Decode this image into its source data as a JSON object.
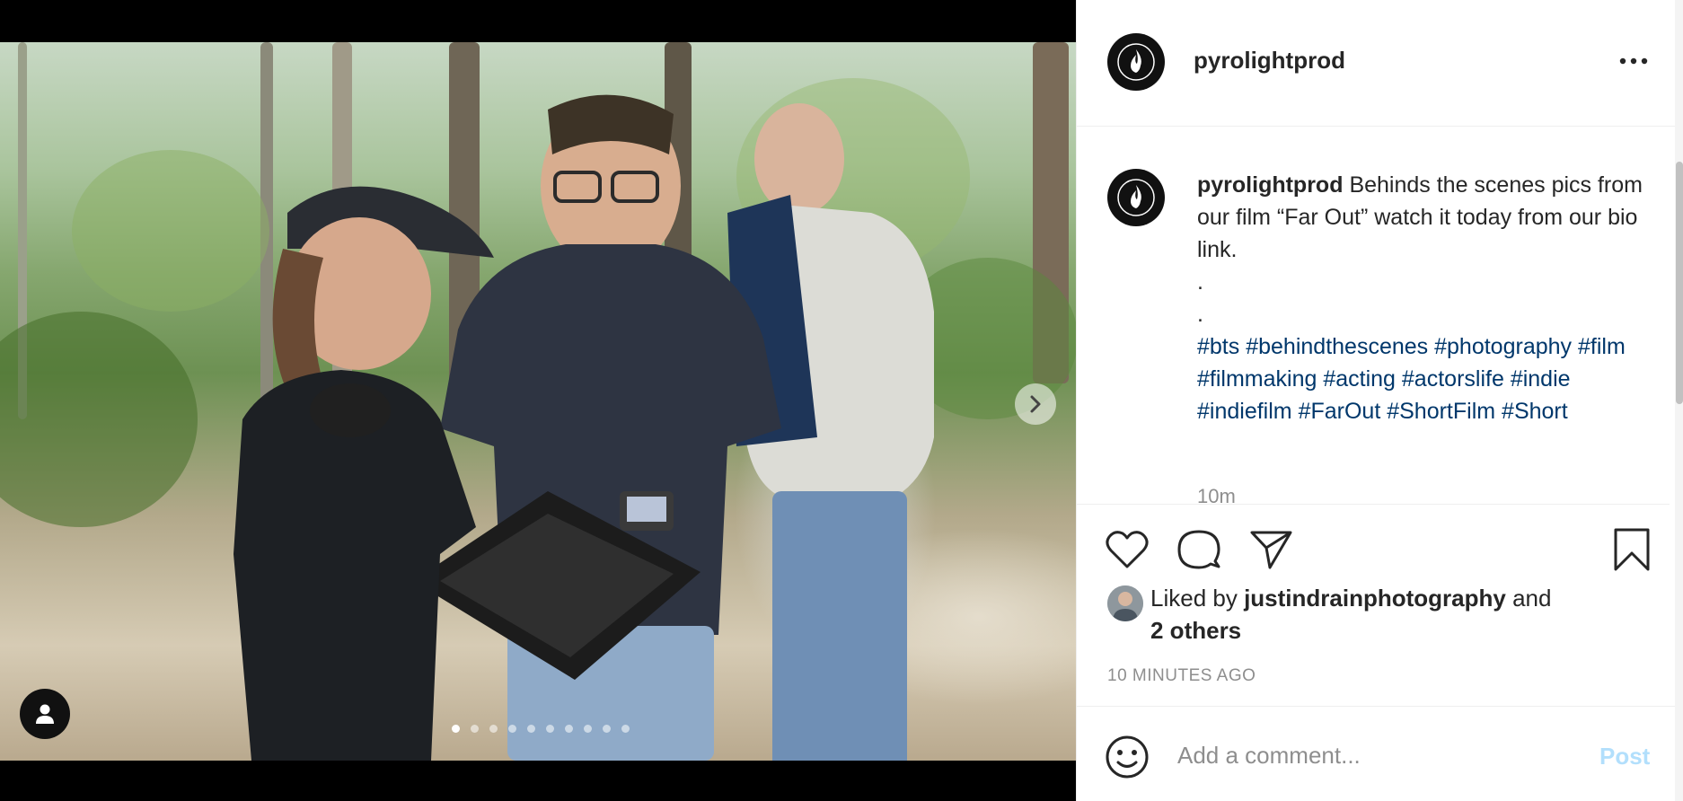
{
  "post": {
    "username": "pyrolightprod",
    "media": {
      "carousel_count": 10,
      "active_index": 0,
      "next_icon": "chevron-right-icon",
      "user_tag_icon": "person-icon"
    },
    "header": {
      "username": "pyrolightprod",
      "more_icon": "more-horizontal-icon"
    },
    "caption": {
      "username": "pyrolightprod",
      "text": "Behinds the scenes pics from our film “Far Out” watch it today from our bio link.",
      "dot1": ".",
      "dot2": ".",
      "hashtags": [
        "#bts",
        "#behindthescenes",
        "#photography",
        "#film",
        "#filmmaking",
        "#acting",
        "#actorslife",
        "#indie",
        "#indiefilm",
        "#FarOut",
        "#ShortFilm",
        "#Short"
      ],
      "timestamp_partial": "10m"
    },
    "actions": {
      "like_icon": "heart-icon",
      "comment_icon": "comment-icon",
      "share_icon": "send-icon",
      "save_icon": "bookmark-icon"
    },
    "likes": {
      "prefix": "Liked by",
      "user": "justindrainphotography",
      "conjunction": "and",
      "others": "2 others"
    },
    "time_ago": "10 MINUTES AGO",
    "comment": {
      "placeholder": "Add a comment...",
      "post_label": "Post",
      "emoji_icon": "smiley-icon"
    },
    "colors": {
      "hashtag": "#00376b",
      "post_button": "#b2dffc",
      "muted": "#8e8e8e"
    }
  }
}
